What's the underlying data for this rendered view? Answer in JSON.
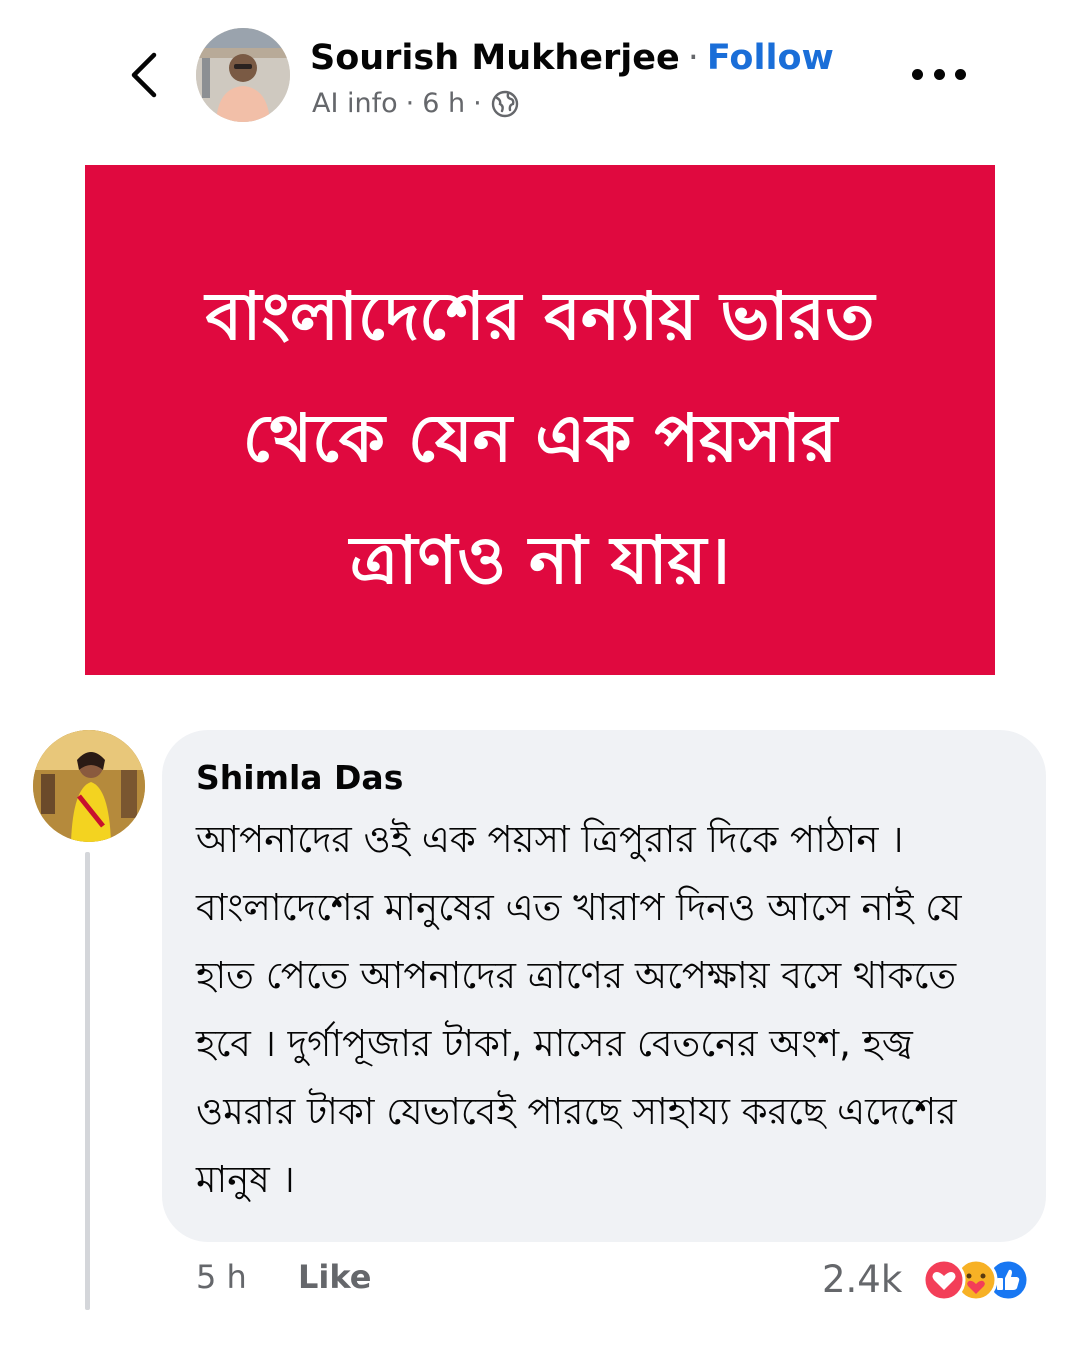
{
  "header": {
    "back_icon": "chevron-left-icon",
    "author_name": "Sourish Mukherjee",
    "separator": "·",
    "follow_label": "Follow",
    "ai_info": "AI info",
    "time": "6 h",
    "audience_icon": "globe-icon",
    "more_icon": "more-horizontal-icon"
  },
  "post": {
    "background": "#e0093f",
    "text_lines": [
      "বাংলাদেশের বন্যায় ভারত",
      "থেকে যেন এক পয়সার",
      "ত্রাণও না যায়।"
    ]
  },
  "comment": {
    "author": "Shimla Das",
    "text": "আপনাদের ওই এক পয়সা ত্রিপুরার দিকে পাঠান ।বাংলাদেশের মানুষের এত খারাপ দিনও আসে নাই যে হাত পেতে আপনাদের ত্রাণের অপেক্ষায় বসে থাকতে হবে । দুর্গাপূজার টাকা, মাসের বেতনের অংশ, হজ্ব ওমরার টাকা যেভাবেই পারছে সাহায্য করছে এদেশের মানুষ ।",
    "time": "5 h",
    "like_label": "Like",
    "reaction_count": "2.4k",
    "reactions": [
      "love-reaction-icon",
      "care-reaction-icon",
      "like-reaction-icon"
    ]
  },
  "colors": {
    "accent": "#1a6ed8",
    "post_background": "#e0093f",
    "bubble_background": "#f0f2f5",
    "secondary_text": "#65676b",
    "love": "#f33e58",
    "care": "#f7b125",
    "like": "#1877f2"
  }
}
